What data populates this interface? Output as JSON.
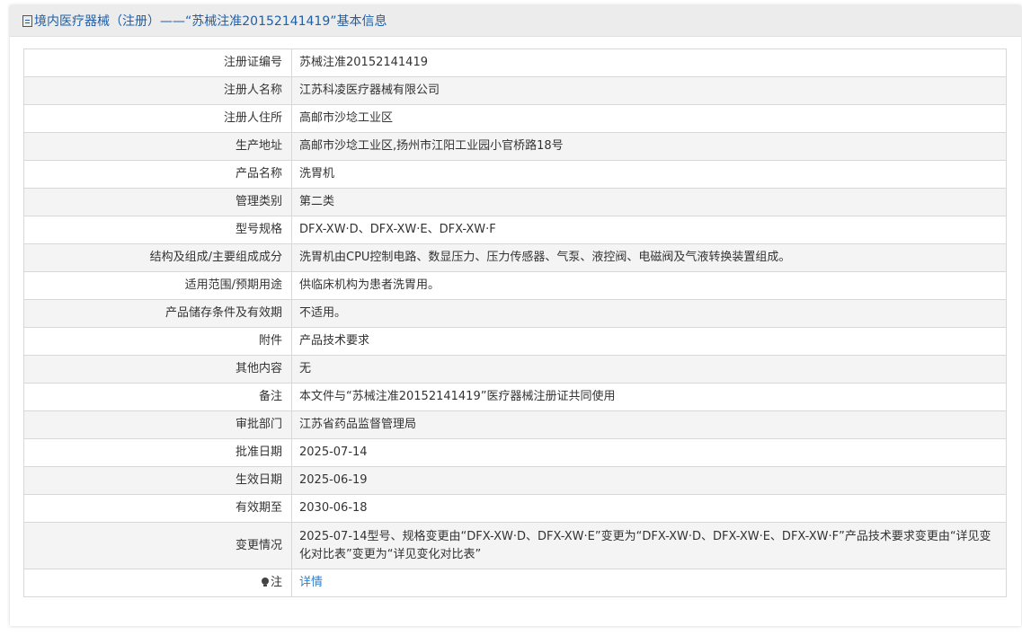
{
  "header": {
    "title": "境内医疗器械（注册）——“苏械注准20152141419”基本信息"
  },
  "rows": [
    {
      "label": "注册证编号",
      "value": "苏械注准20152141419"
    },
    {
      "label": "注册人名称",
      "value": "江苏科凌医疗器械有限公司"
    },
    {
      "label": "注册人住所",
      "value": "高邮市沙埝工业区"
    },
    {
      "label": "生产地址",
      "value": "高邮市沙埝工业区,扬州市江阳工业园小官桥路18号"
    },
    {
      "label": "产品名称",
      "value": "洗胃机"
    },
    {
      "label": "管理类别",
      "value": "第二类"
    },
    {
      "label": "型号规格",
      "value": "DFX-XW·D、DFX-XW·E、DFX-XW·F"
    },
    {
      "label": "结构及组成/主要组成成分",
      "value": "洗胃机由CPU控制电路、数显压力、压力传感器、气泵、液控阀、电磁阀及气液转换装置组成。"
    },
    {
      "label": "适用范围/预期用途",
      "value": "供临床机构为患者洗胃用。"
    },
    {
      "label": "产品储存条件及有效期",
      "value": "不适用。"
    },
    {
      "label": "附件",
      "value": "产品技术要求"
    },
    {
      "label": "其他内容",
      "value": "无"
    },
    {
      "label": "备注",
      "value": "本文件与“苏械注准20152141419”医疗器械注册证共同使用"
    },
    {
      "label": "审批部门",
      "value": "江苏省药品监督管理局"
    },
    {
      "label": "批准日期",
      "value": "2025-07-14"
    },
    {
      "label": "生效日期",
      "value": "2025-06-19"
    },
    {
      "label": "有效期至",
      "value": "2030-06-18"
    },
    {
      "label": "变更情况",
      "value": "2025-07-14型号、规格变更由“DFX-XW·D、DFX-XW·E”变更为“DFX-XW·D、DFX-XW·E、DFX-XW·F”产品技术要求变更由“详见变化对比表”变更为“详见变化对比表”"
    }
  ],
  "note": {
    "label": "注",
    "link_text": "详情"
  },
  "colors": {
    "header_text": "#1e5fa6",
    "link": "#2a7fd4",
    "alt_row": "#f4f4f4",
    "border": "#d8d8d8"
  }
}
